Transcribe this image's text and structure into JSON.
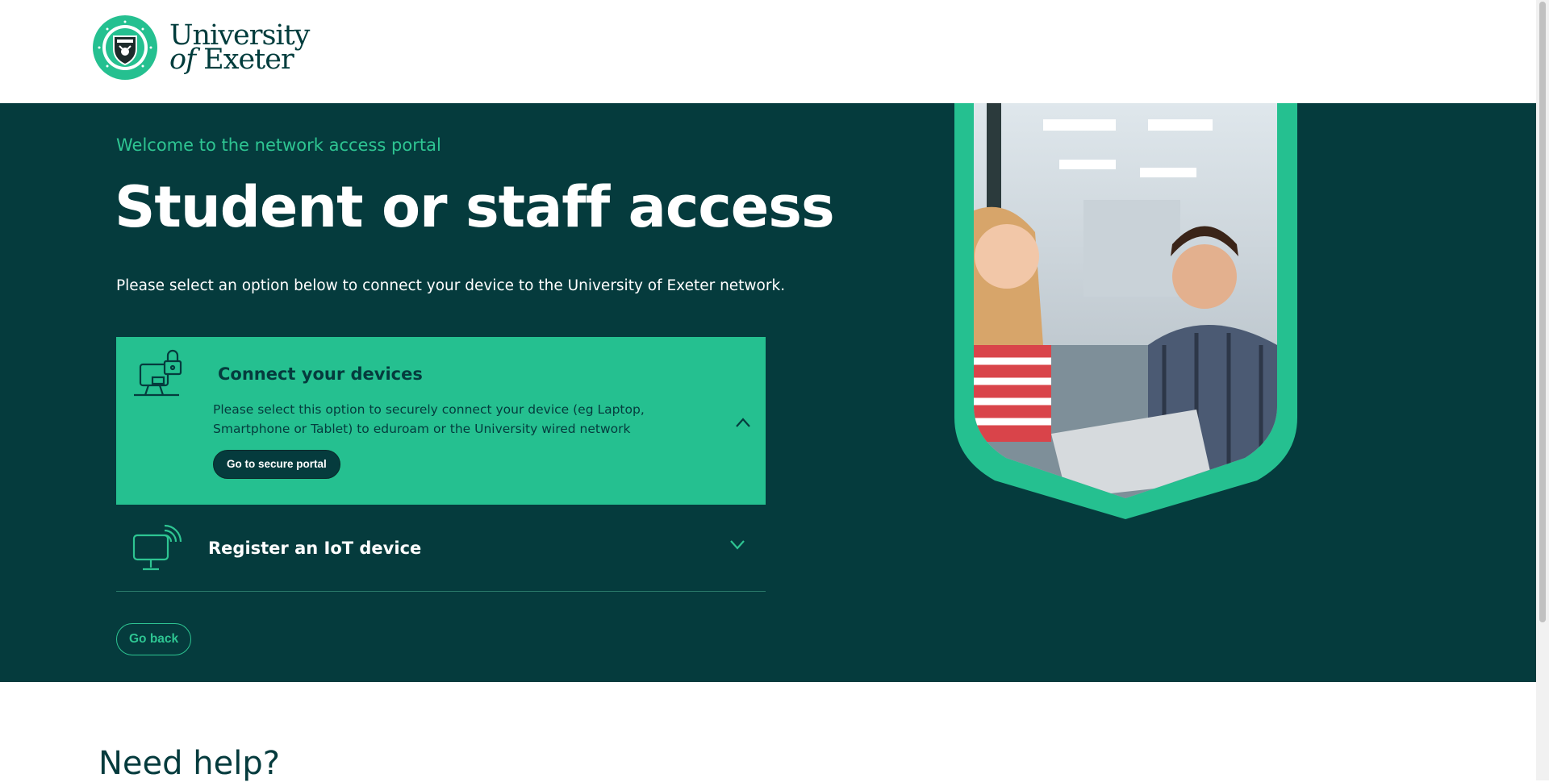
{
  "brand": {
    "name_line1": "University",
    "name_line2_of": "of",
    "name_line2": "Exeter",
    "colors": {
      "dark_teal": "#053b3d",
      "green": "#25c090",
      "light_green": "#2ec592",
      "white": "#ffffff"
    }
  },
  "hero": {
    "welcome": "Welcome to the network access portal",
    "title": "Student or staff access",
    "intro": "Please select an option below to connect your device to the University of Exeter network."
  },
  "accordion": [
    {
      "icon": "laptop-lock-icon",
      "heading": "Connect your devices",
      "description": "Please select this option to securely connect your device (eg Laptop, Smartphone or Tablet) to eduroam or the University wired network",
      "button_label": "Go to secure portal",
      "expanded": true
    },
    {
      "icon": "monitor-wireless-icon",
      "heading": "Register an IoT device",
      "expanded": false
    }
  ],
  "back_button": "Go back",
  "help": {
    "title": "Need help?"
  }
}
